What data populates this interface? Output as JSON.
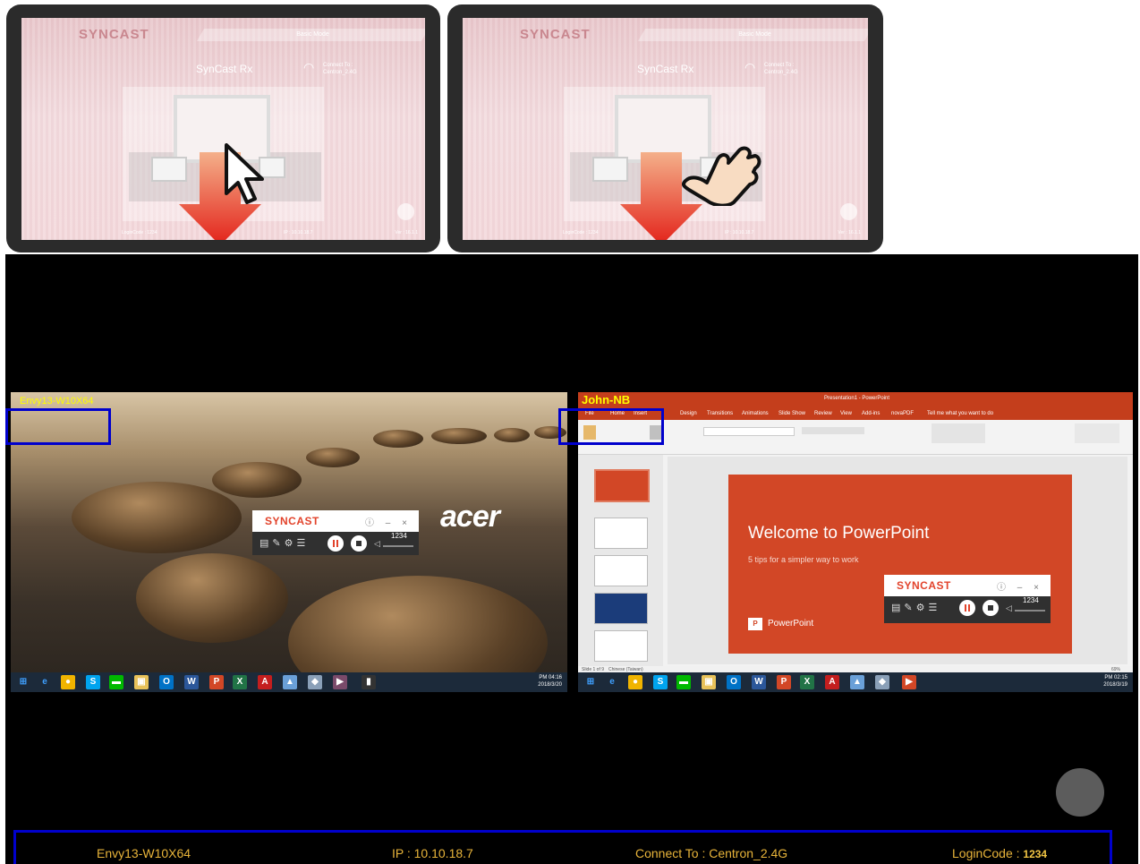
{
  "tablet_preview": {
    "logo": "SYNCAST",
    "mode_label": "Basic Mode",
    "title": "SynCast Rx",
    "connect_label": "Connect To :",
    "connect_value": "Centron_2.4G",
    "login_code": "LoginCode : 1234",
    "ip": "IP : 10.10.18.7",
    "version": "Ver : 16.1.1"
  },
  "left_pane": {
    "label": "Envy13-W10X64",
    "brand_logo": "acer",
    "clock_time": "PM 04:16",
    "clock_date": "2018/3/20"
  },
  "right_pane": {
    "window_name": "John-NB",
    "doc_title": "Presentation1 - PowerPoint",
    "tabs": [
      "File",
      "Home",
      "Insert",
      "Design",
      "Transitions",
      "Animations",
      "Slide Show",
      "Review",
      "View",
      "Add-ins",
      "novaPDF",
      "Tell me what you want to do"
    ],
    "slide_title": "Welcome to PowerPoint",
    "slide_subtitle": "5 tips for a simpler way to work",
    "slide_brand": "PowerPoint",
    "status_left": "Slide 1 of 9",
    "status_lang": "Chinese (Taiwan)",
    "zoom": "69%",
    "clock_time": "PM 02:15",
    "clock_date": "2018/3/19"
  },
  "widget": {
    "brand": "SYNCAST",
    "controls": "ⓘ – ×",
    "code": "1234"
  },
  "info_bar": {
    "host": "Envy13-W10X64",
    "ip": "IP : 10.10.18.7",
    "connect": "Connect To : Centron_2.4G",
    "login_label": "LoginCode :",
    "login_value": "1234"
  },
  "colors": {
    "highlight": "#0000cc",
    "info_text": "#e8b43a",
    "syncast_red": "#e2432b",
    "ppt_orange": "#d24726"
  }
}
